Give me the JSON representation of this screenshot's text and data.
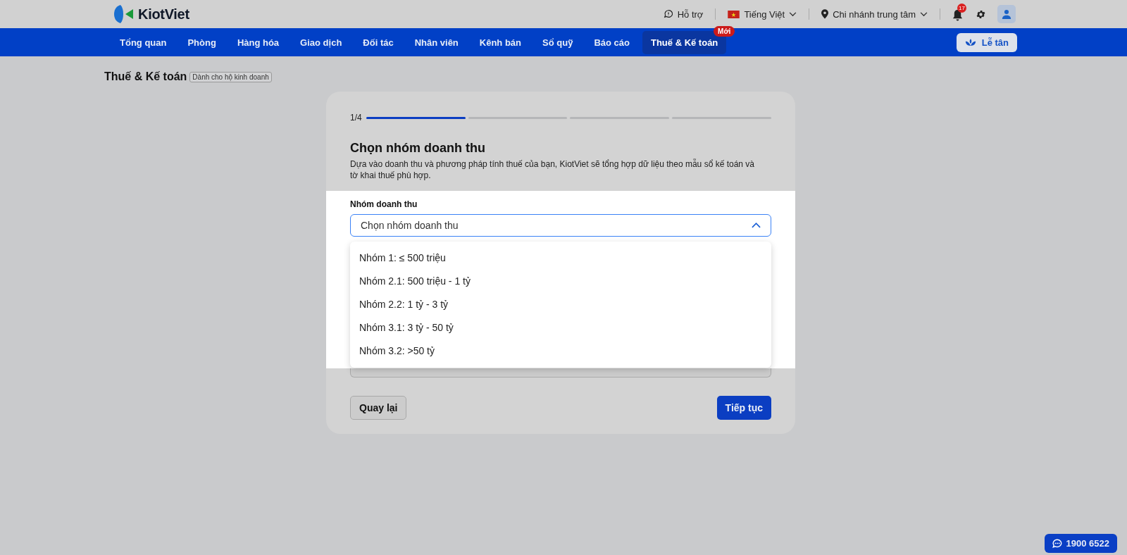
{
  "header": {
    "logo": "KiotViet",
    "support": "Hỗ trợ",
    "language": "Tiếng Việt",
    "branch": "Chi nhánh trung tâm",
    "notification_count": "17"
  },
  "nav": {
    "items": [
      {
        "label": "Tổng quan",
        "selected": false
      },
      {
        "label": "Phòng",
        "selected": false
      },
      {
        "label": "Hàng hóa",
        "selected": false
      },
      {
        "label": "Giao dịch",
        "selected": false
      },
      {
        "label": "Đối tác",
        "selected": false
      },
      {
        "label": "Nhân viên",
        "selected": false
      },
      {
        "label": "Kênh bán",
        "selected": false
      },
      {
        "label": "Sổ quỹ",
        "selected": false
      },
      {
        "label": "Báo cáo",
        "selected": false
      },
      {
        "label": "Thuế & Kế toán",
        "selected": true,
        "badge": "Mới"
      }
    ],
    "reception_button": "Lễ tân"
  },
  "page": {
    "title": "Thuế & Kế toán",
    "tag": "Dành cho hộ kinh doanh"
  },
  "wizard": {
    "step": "1/4",
    "steps": [
      {
        "done": true
      },
      {
        "done": false
      },
      {
        "done": false
      },
      {
        "done": false
      }
    ],
    "heading": "Chọn nhóm doanh thu",
    "description": "Dựa vào doanh thu và phương pháp tính thuế của bạn, KiotViet sẽ tổng hợp dữ liệu theo mẫu sổ kế toán và tờ khai thuế phù hợp.",
    "field": {
      "label": "Nhóm doanh thu",
      "placeholder": "Chọn nhóm doanh thu",
      "expanded": true,
      "options": [
        "Nhóm 1: ≤ 500 triệu",
        "Nhóm 2.1: 500 triệu - 1 tỷ",
        "Nhóm 2.2: 1 tỷ - 3 tỷ",
        "Nhóm 3.1: 3 tỷ - 50 tỷ",
        "Nhóm 3.2: >50 tỷ"
      ]
    },
    "back_button": "Quay lại",
    "next_button": "Tiếp tục"
  },
  "hotline": "1900 6522"
}
